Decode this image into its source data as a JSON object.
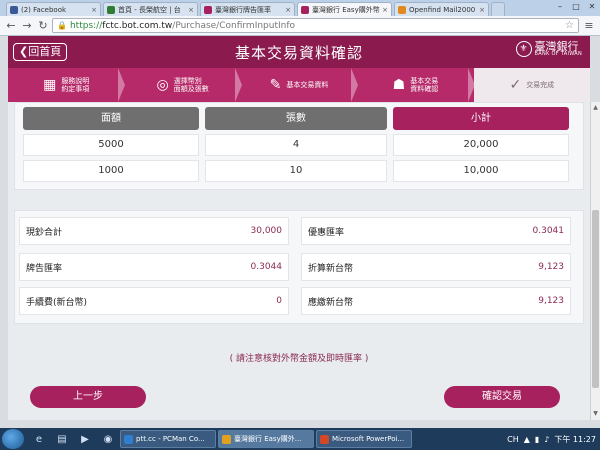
{
  "browser": {
    "tabs": [
      {
        "label": "(2) Facebook",
        "color": "#3b5998",
        "active": false
      },
      {
        "label": "首頁 - 長榮航空 | 台",
        "color": "#2e7d32",
        "active": false
      },
      {
        "label": "臺灣銀行牌告匯率",
        "color": "#a8215f",
        "active": false
      },
      {
        "label": "臺灣銀行 Easy購外幣",
        "color": "#a8215f",
        "active": true
      },
      {
        "label": "Openfind Mail2000",
        "color": "#e08a1e",
        "active": false
      }
    ],
    "tab_close": "×",
    "new_tab": "",
    "window_controls": [
      "–",
      "□",
      "✕"
    ],
    "url": {
      "scheme": "https://",
      "host": "fctc.bot.com.tw",
      "path": "/Purchase/ConfirmInputInfo"
    }
  },
  "header": {
    "back_label": "回首頁",
    "title": "基本交易資料確認",
    "bank_name": "臺灣銀行",
    "bank_name_en": "BANK OF TAIWAN"
  },
  "steps": [
    {
      "line1": "服務說明",
      "line2": "約定事項",
      "icon": "grid-icon"
    },
    {
      "line1": "選擇幣別",
      "line2": "面額及張數",
      "icon": "coins-icon"
    },
    {
      "line1": "基本交易資料",
      "line2": "",
      "icon": "edit-icon"
    },
    {
      "line1": "基本交易",
      "line2": "資料確認",
      "icon": "person-icon"
    },
    {
      "line1": "交易完成",
      "line2": "",
      "icon": "check-icon"
    }
  ],
  "denomination_table": {
    "headers": [
      "面額",
      "張數",
      "小計"
    ],
    "header_colors": [
      "#6f6f6f",
      "#6f6f6f",
      "#a8215f"
    ],
    "rows": [
      [
        "5000",
        "4",
        "20,000"
      ],
      [
        "1000",
        "10",
        "10,000"
      ]
    ]
  },
  "summary": {
    "left": [
      {
        "label": "現鈔合計",
        "value": "30,000"
      },
      {
        "label": "牌告匯率",
        "value": "0.3044"
      },
      {
        "label": "手續費(新台幣)",
        "value": "0"
      }
    ],
    "right": [
      {
        "label": "優惠匯率",
        "value": "0.3041"
      },
      {
        "label": "折算新台幣",
        "value": "9,123"
      },
      {
        "label": "應繳新台幣",
        "value": "9,123"
      }
    ]
  },
  "notice": "( 請注意核對外幣金額及即時匯率 )",
  "buttons": {
    "prev": "上一步",
    "confirm": "確認交易"
  },
  "taskbar": {
    "items": [
      {
        "label": "ptt.cc - PCMan Co...",
        "color": "#2f7fd1",
        "active": false
      },
      {
        "label": "臺灣銀行 Easy購外...",
        "color": "#e0a11e",
        "active": true
      },
      {
        "label": "Microsoft PowerPoi...",
        "color": "#d24726",
        "active": false
      }
    ],
    "lang": "CH",
    "time": "下午 11:27"
  }
}
